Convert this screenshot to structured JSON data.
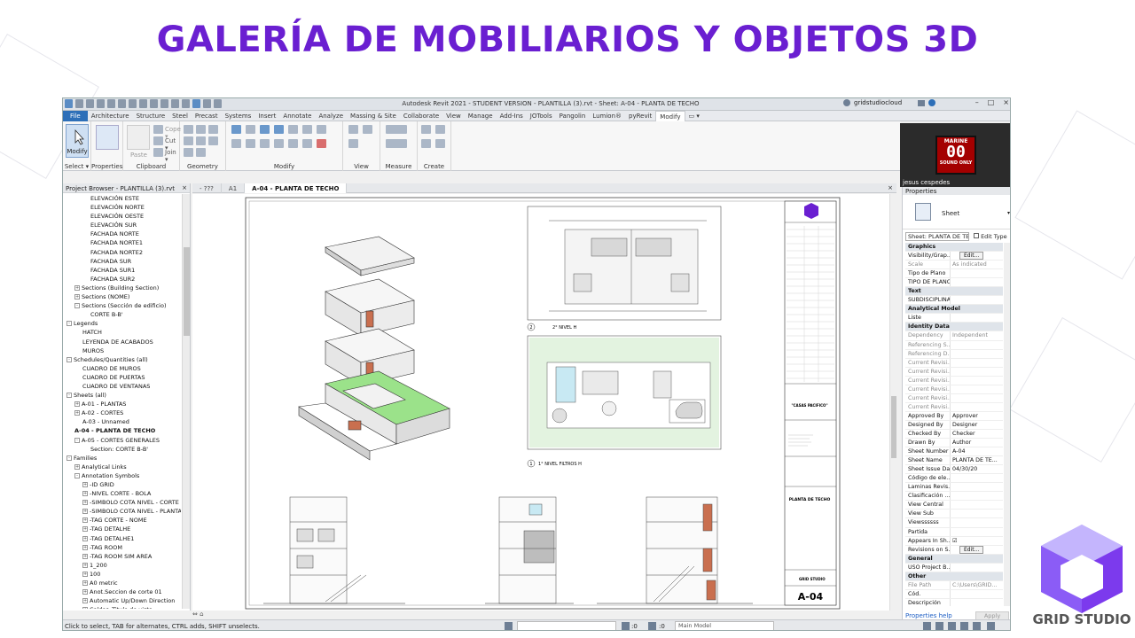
{
  "slide": {
    "title": "GALERÍA DE MOBILIARIOS Y OBJETOS 3D",
    "title_color": "#6a1fd1",
    "logo_text": "GRID STUDIO",
    "logo_color": "#8b5cf6"
  },
  "window": {
    "title": "Autodesk Revit 2021 - STUDENT VERSION - PLANTILLA (3).rvt - Sheet: A-04 - PLANTA DE TECHO",
    "user": "gridstudiocloud",
    "controls": [
      "–",
      "□",
      "×"
    ]
  },
  "ribbon": {
    "tabs": [
      "File",
      "Architecture",
      "Structure",
      "Steel",
      "Precast",
      "Systems",
      "Insert",
      "Annotate",
      "Analyze",
      "Massing & Site",
      "Collaborate",
      "View",
      "Manage",
      "Add-Ins",
      "JOTools",
      "Pangolin",
      "Lumion®",
      "pyRevit",
      "Modify",
      "▭ ▾"
    ],
    "active_tab": "Modify",
    "modify_button": "Modify",
    "panels": [
      "Select ▾",
      "Properties",
      "Clipboard",
      "Geometry",
      "Modify",
      "View",
      "Measure",
      "Create"
    ],
    "clipboard_items": [
      "Paste",
      "Cope ▾",
      "Cut ▾",
      "Join ▾"
    ]
  },
  "video": {
    "sign_line1": "MARINE",
    "sign_line2": "00",
    "sign_line3": "SOUND ONLY",
    "name": "jesus cespedes"
  },
  "project_browser": {
    "title": "Project Browser - PLANTILLA (3).rvt",
    "close": "×",
    "items": [
      {
        "indent": 3,
        "text": "ELEVACIÓN ESTE",
        "toggle": ""
      },
      {
        "indent": 3,
        "text": "ELEVACIÓN NORTE",
        "toggle": ""
      },
      {
        "indent": 3,
        "text": "ELEVACIÓN OESTE",
        "toggle": ""
      },
      {
        "indent": 3,
        "text": "ELEVACIÓN SUR",
        "toggle": ""
      },
      {
        "indent": 3,
        "text": "FACHADA NORTE",
        "toggle": ""
      },
      {
        "indent": 3,
        "text": "FACHADA NORTE1",
        "toggle": ""
      },
      {
        "indent": 3,
        "text": "FACHADA NORTE2",
        "toggle": ""
      },
      {
        "indent": 3,
        "text": "FACHADA SUR",
        "toggle": ""
      },
      {
        "indent": 3,
        "text": "FACHADA SUR1",
        "toggle": ""
      },
      {
        "indent": 3,
        "text": "FACHADA SUR2",
        "toggle": ""
      },
      {
        "indent": 1,
        "text": "Sections (Building Section)",
        "toggle": "+"
      },
      {
        "indent": 1,
        "text": "Sections (NOME)",
        "toggle": "+"
      },
      {
        "indent": 1,
        "text": "Sections (Sección de edificio)",
        "toggle": "-"
      },
      {
        "indent": 3,
        "text": "CORTE B-B'",
        "toggle": ""
      },
      {
        "indent": 0,
        "text": "Legends",
        "toggle": "-"
      },
      {
        "indent": 2,
        "text": "HATCH",
        "toggle": ""
      },
      {
        "indent": 2,
        "text": "LEYENDA DE ACABADOS",
        "toggle": ""
      },
      {
        "indent": 2,
        "text": "MUROS",
        "toggle": ""
      },
      {
        "indent": 0,
        "text": "Schedules/Quantities (all)",
        "toggle": "-"
      },
      {
        "indent": 2,
        "text": "CUADRO DE MUROS",
        "toggle": ""
      },
      {
        "indent": 2,
        "text": "CUADRO DE PUERTAS",
        "toggle": ""
      },
      {
        "indent": 2,
        "text": "CUADRO DE VENTANAS",
        "toggle": ""
      },
      {
        "indent": 0,
        "text": "Sheets (all)",
        "toggle": "-"
      },
      {
        "indent": 1,
        "text": "A-01 - PLANTAS",
        "toggle": "+"
      },
      {
        "indent": 1,
        "text": "A-02 - CORTES",
        "toggle": "+"
      },
      {
        "indent": 2,
        "text": "A-03 - Unnamed",
        "toggle": ""
      },
      {
        "indent": 1,
        "text": "A-04 - PLANTA DE TECHO",
        "toggle": "",
        "bold": true
      },
      {
        "indent": 1,
        "text": "A-05 - CORTES GENERALES",
        "toggle": "-"
      },
      {
        "indent": 3,
        "text": "Section: CORTE B-B'",
        "toggle": ""
      },
      {
        "indent": 0,
        "text": "Families",
        "toggle": "-"
      },
      {
        "indent": 1,
        "text": "Analytical Links",
        "toggle": "+"
      },
      {
        "indent": 1,
        "text": "Annotation Symbols",
        "toggle": "-"
      },
      {
        "indent": 2,
        "text": "-ID GRID",
        "toggle": "+"
      },
      {
        "indent": 2,
        "text": "-NIVEL CORTE - BOLA",
        "toggle": "+"
      },
      {
        "indent": 2,
        "text": "-SIMBOLO COTA NIVEL - CORTE",
        "toggle": "+"
      },
      {
        "indent": 2,
        "text": "-SIMBOLO COTA NIVEL - PLANTA",
        "toggle": "+"
      },
      {
        "indent": 2,
        "text": "-TAG CORTE - NOME",
        "toggle": "+"
      },
      {
        "indent": 2,
        "text": "-TAG DETALHE",
        "toggle": "+"
      },
      {
        "indent": 2,
        "text": "-TAG DETALHE1",
        "toggle": "+"
      },
      {
        "indent": 2,
        "text": "-TAG ROOM",
        "toggle": "+"
      },
      {
        "indent": 2,
        "text": "-TAG ROOM SIM AREA",
        "toggle": "+"
      },
      {
        "indent": 2,
        "text": "1_200",
        "toggle": "+"
      },
      {
        "indent": 2,
        "text": "100",
        "toggle": "+"
      },
      {
        "indent": 2,
        "text": "A0 metric",
        "toggle": "+"
      },
      {
        "indent": 2,
        "text": "Anot.Seccion de corte 01",
        "toggle": "+"
      },
      {
        "indent": 2,
        "text": "Automatic Up/Down Direction",
        "toggle": "+"
      },
      {
        "indent": 2,
        "text": "Caldas_Titulo de vista",
        "toggle": "+"
      }
    ]
  },
  "view_tabs": [
    {
      "label": "- ???",
      "active": false
    },
    {
      "label": "A1",
      "active": false
    },
    {
      "label": "A-04 - PLANTA DE TECHO",
      "active": true
    }
  ],
  "sheet": {
    "plan_label_2": "2° NIVEL H",
    "plan_label_1": "1° NIVEL FILTROS H",
    "client_block": "\"CASAS PACIFICO\"",
    "sheet_title": "PLANTA DE TECHO",
    "company": "GRID STUDIO",
    "sheet_number": "A-04",
    "num_2": "2",
    "num_1": "1"
  },
  "properties": {
    "title": "Properties",
    "close": "×",
    "type_name": "Sheet",
    "filter": "Sheet: PLANTA DE TE",
    "edit_type": "Edit Type",
    "rows": [
      {
        "k": "Graphics",
        "v": "",
        "cat": true
      },
      {
        "k": "Visibility/Grap...",
        "v": "Edit...",
        "btn": true
      },
      {
        "k": "Scale",
        "v": "As indicated",
        "grey": true
      },
      {
        "k": "Tipo de Plano",
        "v": ""
      },
      {
        "k": "TIPO DE PLANO",
        "v": ""
      },
      {
        "k": "Text",
        "v": "",
        "cat": true
      },
      {
        "k": "SUBDISCIPLINA",
        "v": ""
      },
      {
        "k": "Analytical Model",
        "v": "",
        "cat": true
      },
      {
        "k": "Liste",
        "v": ""
      },
      {
        "k": "Identity Data",
        "v": "",
        "cat": true
      },
      {
        "k": "Dependency",
        "v": "Independent",
        "grey": true
      },
      {
        "k": "Referencing S...",
        "v": "",
        "grey": true
      },
      {
        "k": "Referencing D...",
        "v": "",
        "grey": true
      },
      {
        "k": "Current Revisi...",
        "v": "",
        "grey": true
      },
      {
        "k": "Current Revisi...",
        "v": "",
        "grey": true
      },
      {
        "k": "Current Revisi...",
        "v": "",
        "grey": true
      },
      {
        "k": "Current Revisi...",
        "v": "",
        "grey": true
      },
      {
        "k": "Current Revisi...",
        "v": "",
        "grey": true
      },
      {
        "k": "Current Revisi...",
        "v": "",
        "grey": true
      },
      {
        "k": "Approved By",
        "v": "Approver"
      },
      {
        "k": "Designed By",
        "v": "Designer"
      },
      {
        "k": "Checked By",
        "v": "Checker"
      },
      {
        "k": "Drawn By",
        "v": "Author"
      },
      {
        "k": "Sheet Number",
        "v": "A-04"
      },
      {
        "k": "Sheet Name",
        "v": "PLANTA DE TE..."
      },
      {
        "k": "Sheet Issue Date",
        "v": "04/30/20"
      },
      {
        "k": "Código de ele...",
        "v": ""
      },
      {
        "k": "Laminas Revis...",
        "v": ""
      },
      {
        "k": "Clasificación ...",
        "v": ""
      },
      {
        "k": "View Central",
        "v": ""
      },
      {
        "k": "View Sub",
        "v": ""
      },
      {
        "k": "Viewssssss",
        "v": ""
      },
      {
        "k": "Partida",
        "v": ""
      },
      {
        "k": "Appears In Sh...",
        "v": "☑"
      },
      {
        "k": "Revisions on S...",
        "v": "Edit...",
        "btn": true
      },
      {
        "k": "General",
        "v": "",
        "cat": true
      },
      {
        "k": "USO Project B...",
        "v": ""
      },
      {
        "k": "Other",
        "v": "",
        "cat": true
      },
      {
        "k": "File Path",
        "v": "C:\\Users\\GRID...",
        "grey": true
      },
      {
        "k": "Cód.",
        "v": ""
      },
      {
        "k": "Descripción",
        "v": ""
      }
    ],
    "help": "Properties help",
    "apply": "Apply"
  },
  "status": {
    "text": "Click to select, TAB for alternates, CTRL adds, SHIFT unselects.",
    "model": "Main Model",
    "zero_a": ":0",
    "zero_b": ":0"
  },
  "colors": {
    "accent": "#6a1fd1",
    "file_tab": "#2d6fb8",
    "green_floor": "#9be28a",
    "wood": "#c96f4f"
  }
}
